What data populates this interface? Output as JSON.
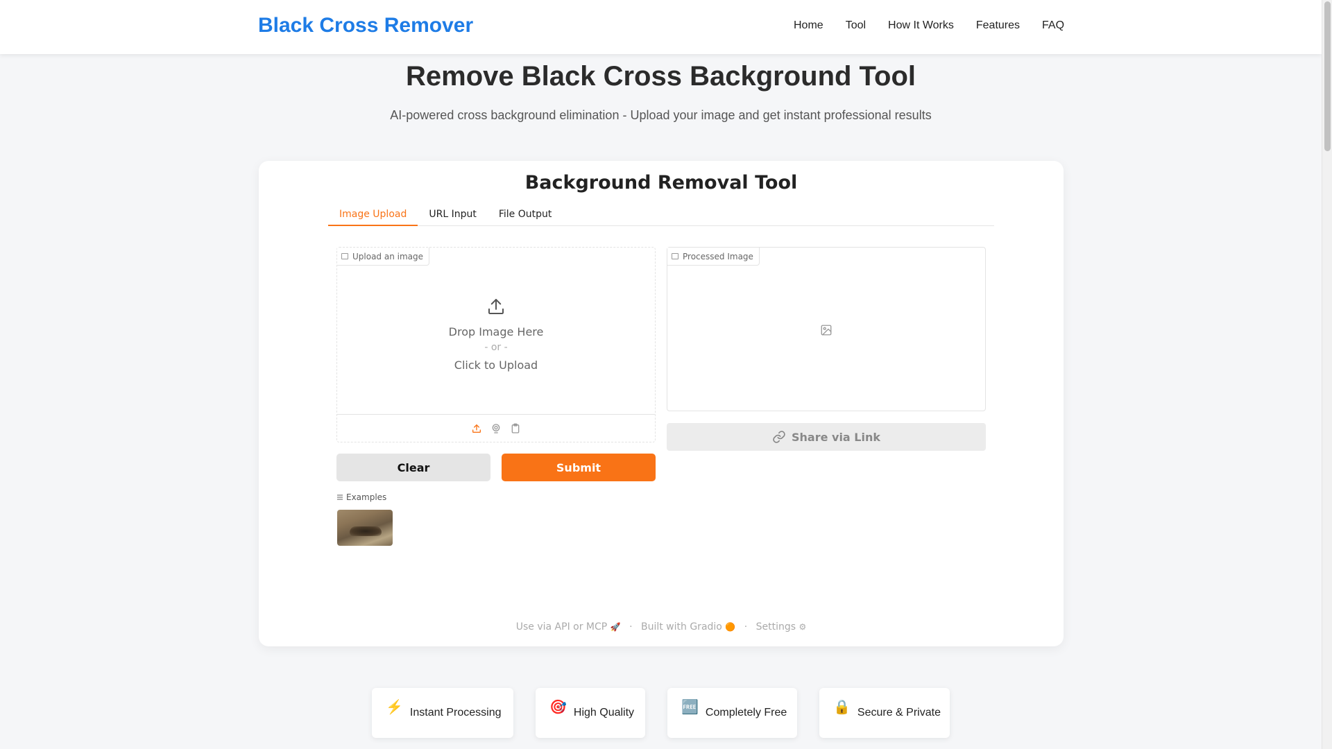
{
  "header": {
    "brand": "Black Cross Remover",
    "nav": [
      "Home",
      "Tool",
      "How It Works",
      "Features",
      "FAQ"
    ]
  },
  "hero": {
    "title": "Remove Black Cross Background Tool",
    "subtitle": "AI-powered cross background elimination - Upload your image and get instant professional results"
  },
  "tool": {
    "title": "Background Removal Tool",
    "tabs": [
      {
        "label": "Image Upload",
        "active": true
      },
      {
        "label": "URL Input",
        "active": false
      },
      {
        "label": "File Output",
        "active": false
      }
    ],
    "upload": {
      "label": "Upload an image",
      "drop_text": "Drop Image Here",
      "or_text": "- or -",
      "click_text": "Click to Upload"
    },
    "output": {
      "label": "Processed Image"
    },
    "share_label": "Share via Link",
    "clear_label": "Clear",
    "submit_label": "Submit",
    "examples_label": "Examples",
    "footer": {
      "api": "Use via API or MCP",
      "gradio": "Built with Gradio",
      "settings": "Settings"
    }
  },
  "features": [
    {
      "icon": "⚡",
      "label": "Instant Processing"
    },
    {
      "icon": "🎯",
      "label": "High Quality"
    },
    {
      "icon": "🆓",
      "label": "Completely Free"
    },
    {
      "icon": "🔒",
      "label": "Secure & Private"
    }
  ],
  "colors": {
    "brand": "#1e7ce6",
    "accent": "#f97316"
  }
}
